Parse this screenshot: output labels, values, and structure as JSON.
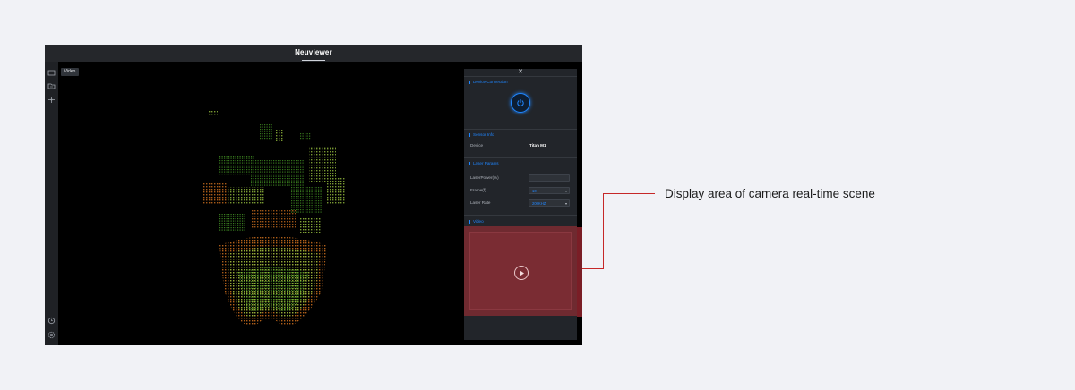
{
  "app": {
    "title": "Neuviewer",
    "video_tab_label": "Video"
  },
  "sidebar": {
    "icons": [
      "folder-icon",
      "folder-open-icon",
      "move-icon",
      "clock-icon",
      "settings-icon"
    ]
  },
  "panel": {
    "close_icon": "close-icon",
    "device_connection": {
      "title": "Device Connection",
      "power_icon": "power-icon"
    },
    "sensor_info": {
      "title": "Sensor Info",
      "device_label": "Device",
      "device_value": "Titan M1"
    },
    "laser_params": {
      "title": "Laser Params",
      "laser_power_label": "LaserPower(%)",
      "laser_power_value": "",
      "frame_label": "Frame(f)",
      "frame_value": "10",
      "laser_rate_label": "Laser Rate",
      "laser_rate_value": "200KHZ"
    },
    "video": {
      "title": "Video",
      "play_icon": "play-icon"
    }
  },
  "annotation": {
    "text": "Display area of camera real-time scene",
    "colors": {
      "line": "#c62828",
      "highlight": "#6f2a30"
    }
  },
  "colors": {
    "accent": "#1f86ff",
    "panel_bg": "#22252a",
    "titlebar_bg": "#25272b",
    "page_bg": "#f1f2f6"
  }
}
